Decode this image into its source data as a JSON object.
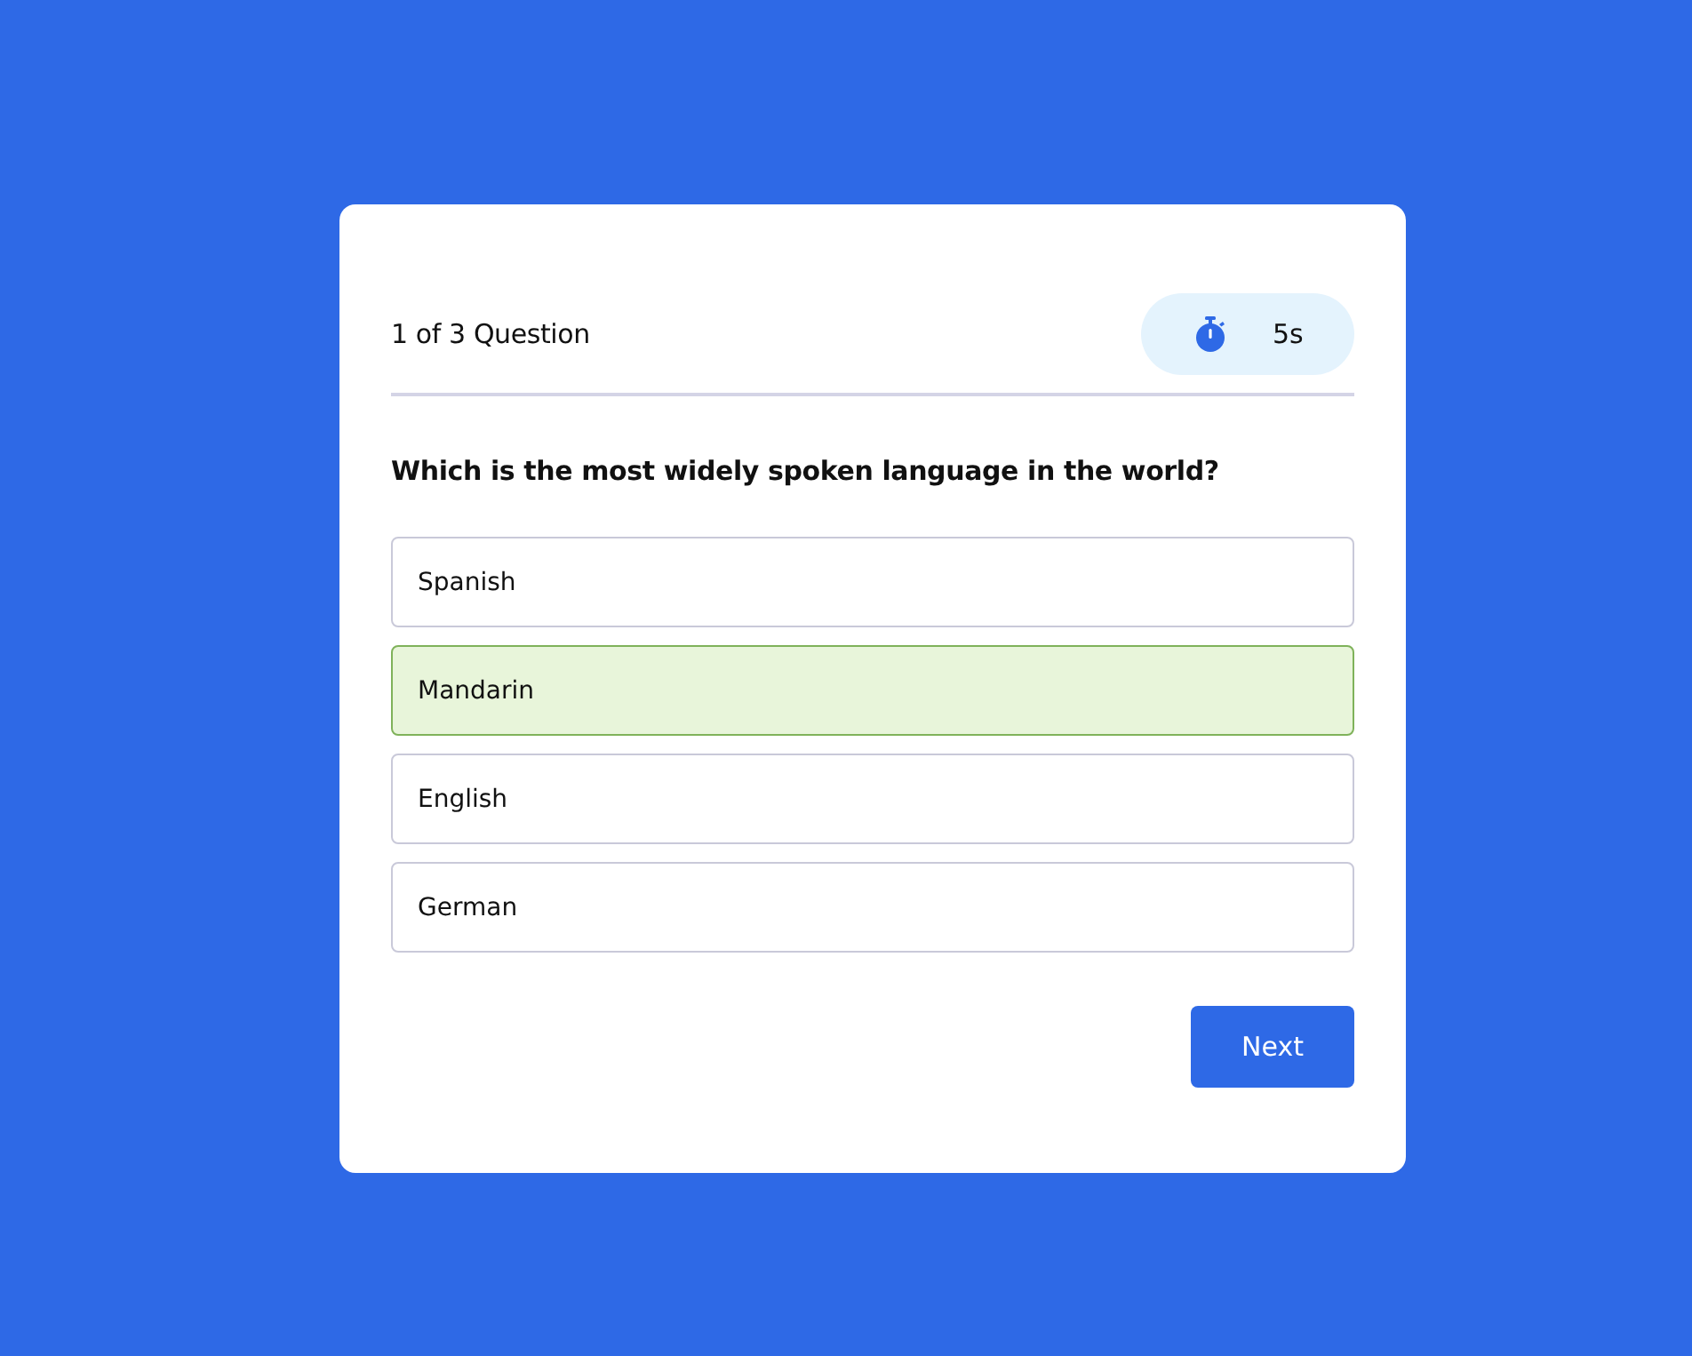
{
  "progress": "1 of 3 Question",
  "timer": {
    "text": "5s"
  },
  "question": "Which is the most widely spoken language in the world?",
  "options": [
    {
      "label": "Spanish",
      "selected": false
    },
    {
      "label": "Mandarin",
      "selected": true
    },
    {
      "label": "English",
      "selected": false
    },
    {
      "label": "German",
      "selected": false
    }
  ],
  "buttons": [
    {
      "label": "Next"
    }
  ]
}
